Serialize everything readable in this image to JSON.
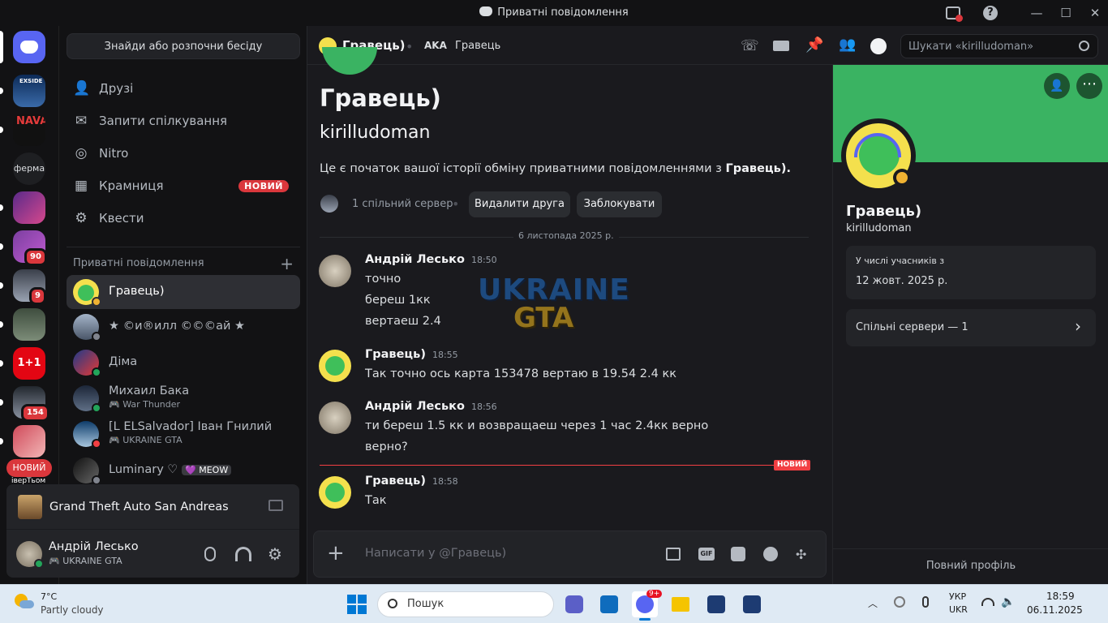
{
  "window": {
    "title": "Приватні повідомлення"
  },
  "sidebar": {
    "find_button": "Знайди або розпочни бесіду",
    "nav": [
      {
        "label": "Друзі",
        "icon": "friends-icon"
      },
      {
        "label": "Запити спілкування",
        "icon": "mail-icon"
      },
      {
        "label": "Nitro",
        "icon": "nitro-icon"
      },
      {
        "label": "Крамниця",
        "icon": "shop-icon",
        "badge": "НОВИЙ"
      },
      {
        "label": "Квести",
        "icon": "quests-icon"
      }
    ],
    "dm_header": "Приватні повідомлення",
    "dms": [
      {
        "name": "Гравець)",
        "sub": "",
        "status": "idle"
      },
      {
        "name": "★ ©и®илл ©©©ай ★",
        "sub": "",
        "status": "offline"
      },
      {
        "name": "Діма",
        "sub": "",
        "status": "online"
      },
      {
        "name": "Михаил Бака",
        "sub": "War Thunder",
        "status": "online"
      },
      {
        "name": "[L ELSalvador] Іван Гнилий",
        "sub": "UKRAINE GTA",
        "status": "dnd"
      },
      {
        "name": "Luminary ♡",
        "sub": "",
        "tag": "MEOW",
        "status": "offline"
      }
    ]
  },
  "rail": {
    "servers": [
      "Discord",
      "EXSIDE",
      "NAVA",
      "ферма"
    ],
    "badges": [
      "90",
      "9",
      "154"
    ],
    "new_pill": "НОВИЙ",
    "partial_label": "іверТьом"
  },
  "activity": {
    "game": "Grand Theft Auto San Andreas"
  },
  "user": {
    "name": "Андрій Лесько",
    "status": "UKRAINE GTA"
  },
  "chat": {
    "header_name": "Гравець)",
    "aka_label": "AKA",
    "aka_value": "Гравець",
    "search_placeholder": "Шукати «kirilludoman»",
    "intro_name": "Гравець)",
    "intro_username": "kirilludoman",
    "intro_text": "Це є початок вашої історії обміну приватними повідомленнями з ",
    "intro_bold": "Гравець).",
    "mutual_label": "1 спільний сервер",
    "remove_friend": "Видалити друга",
    "block": "Заблокувати",
    "date_divider": "6 листопада 2025 р.",
    "new_divider": "НОВИЙ",
    "composer_placeholder": "Написати у @Гравець)",
    "messages": [
      {
        "author": "Андрій Лесько",
        "time": "18:50",
        "lines": [
          "точно",
          "береш 1кк",
          "вертаеш 2.4"
        ]
      },
      {
        "author": "Гравець)",
        "time": "18:55",
        "lines": [
          "Так точно ось карта 153478 вертаю в 19.54 2.4 кк"
        ]
      },
      {
        "author": "Андрій Лесько",
        "time": "18:56",
        "lines": [
          "ти береш 1.5 кк и возвращаеш через 1 час 2.4кк верно",
          "верно?"
        ]
      },
      {
        "author": "Гравець)",
        "time": "18:58",
        "lines": [
          "Так"
        ]
      }
    ]
  },
  "profile": {
    "name": "Гравець)",
    "username": "kirilludoman",
    "member_since_label": "У числі учасників з",
    "member_since": "12 жовт. 2025 р.",
    "mutual_servers": "Спільні сервери — 1",
    "full_profile": "Повний профіль"
  },
  "taskbar": {
    "weather_temp": "7°C",
    "weather_desc": "Partly cloudy",
    "search": "Пошук",
    "discord_badge": "9+",
    "lang1": "УКР",
    "lang2": "UKR",
    "time": "18:59",
    "date": "06.11.2025"
  },
  "colors": {
    "accent": "#5865f2",
    "banner": "#3ab362",
    "online": "#23a55a",
    "idle": "#f0b232",
    "dnd": "#f23f43",
    "offline": "#80848e"
  }
}
